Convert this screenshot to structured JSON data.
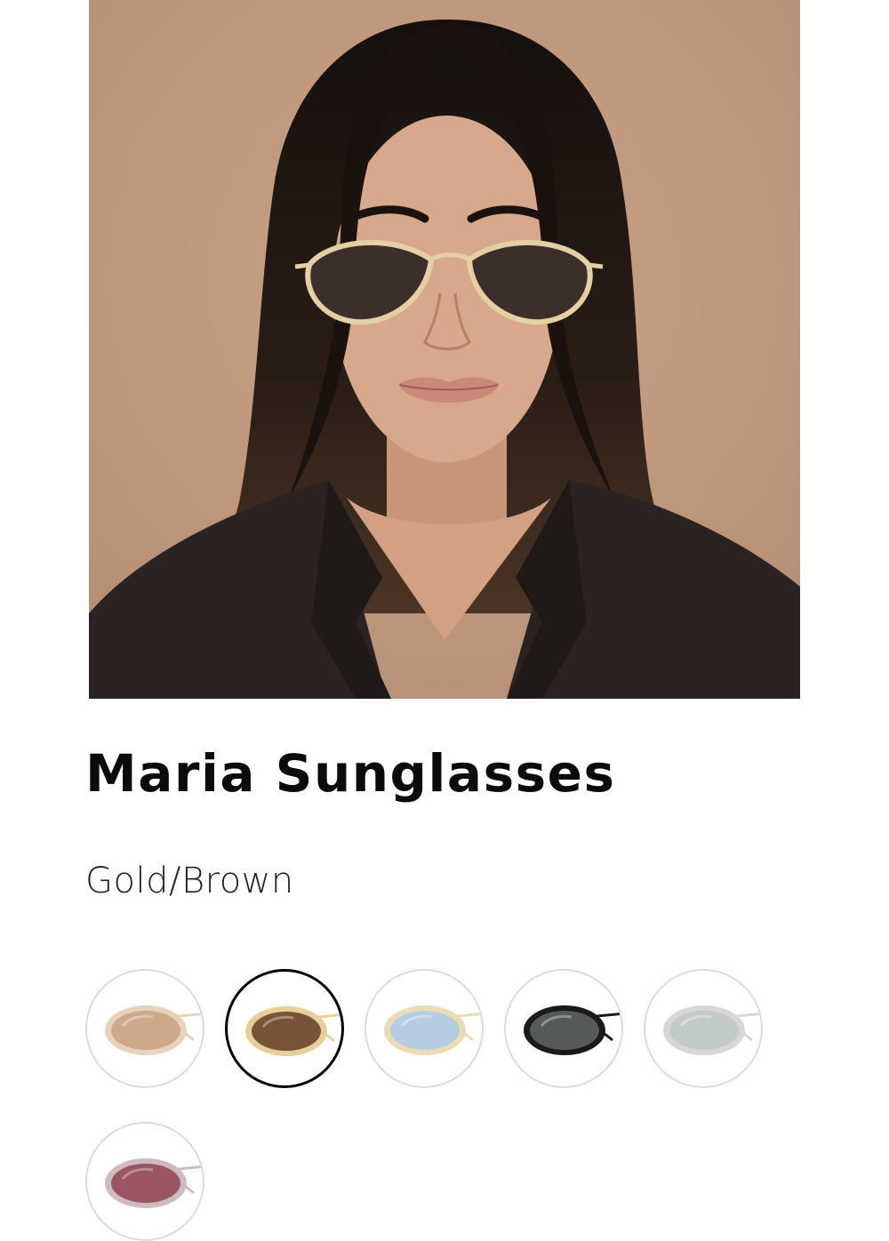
{
  "product": {
    "image_alt": "Woman wearing oval sunglasses with gold metal frame and brown lenses",
    "title": "Maria Sunglasses",
    "selected_color": "Gold/Brown"
  },
  "colors": {
    "background": "#c29a80",
    "hair": "#1c1410",
    "skin": "#d8a98b",
    "blazer": "#2a2321",
    "frame_gold": "#e6cfa5",
    "lens_brown": "#3c2f2b",
    "selected_border": "#000000",
    "swatch_border": "#dcdcdc"
  },
  "swatches": [
    {
      "name": "gold-gradient-brown",
      "frame": "#e6d2bd",
      "lens": "#cfa889",
      "selected": false
    },
    {
      "name": "gold-brown",
      "frame": "#e7cf9a",
      "lens": "#7a5238",
      "selected": true
    },
    {
      "name": "gold-blue",
      "frame": "#ebdcb6",
      "lens": "#b6cde1",
      "selected": false
    },
    {
      "name": "black-grey",
      "frame": "#1a1a1a",
      "lens": "#55595a",
      "selected": false
    },
    {
      "name": "silver-grey",
      "frame": "#d7d7d7",
      "lens": "#c2cbc8",
      "selected": false
    },
    {
      "name": "silver-pink",
      "frame": "#cdbbbf",
      "lens": "#9a5563",
      "selected": false
    }
  ]
}
